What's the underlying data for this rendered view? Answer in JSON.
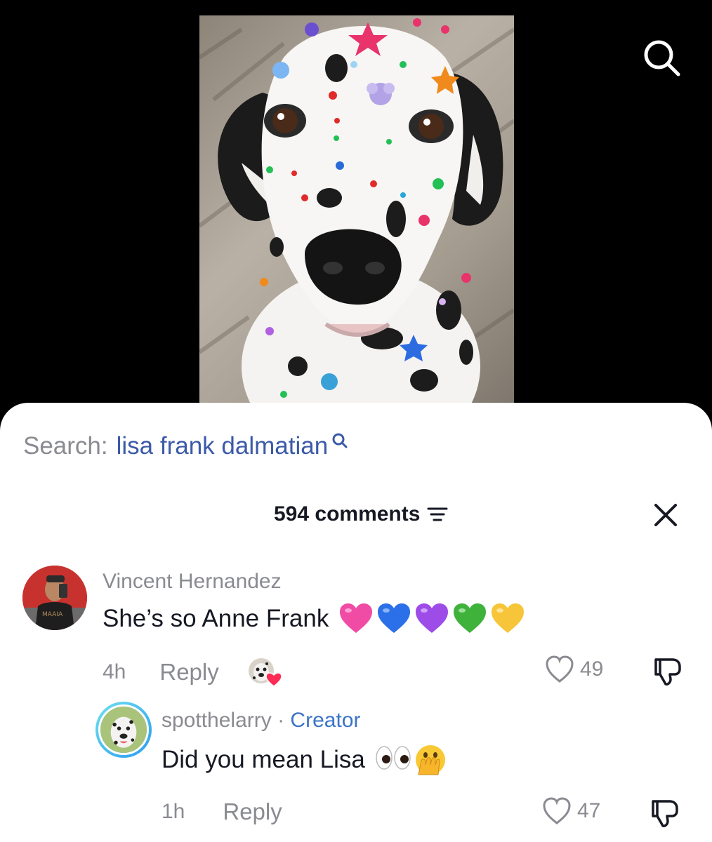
{
  "search_bar": {
    "prefix": "Search:",
    "query": "lisa frank dalmatian"
  },
  "header": {
    "comment_count": "594 comments"
  },
  "comments": [
    {
      "author": "Vincent Hernandez",
      "text": "She’s so Anne Frank",
      "emojis": [
        "pink-heart",
        "blue-heart",
        "purple-heart",
        "green-heart",
        "yellow-heart"
      ],
      "time": "4h",
      "reply_label": "Reply",
      "likes": "49",
      "creator_liked": true
    },
    {
      "author": "spotthelarry",
      "separator": " · ",
      "badge": "Creator",
      "text": "Did you mean Lisa",
      "emojis": [
        "eyes",
        "face-with-open-eyes-and-hand-over-mouth"
      ],
      "time": "1h",
      "reply_label": "Reply",
      "likes": "47"
    }
  ],
  "colors": {
    "accent_blue": "#3b5aa8",
    "creator_blue": "#3b74c8",
    "muted_text": "#8a8b91",
    "primary_text": "#161823"
  }
}
